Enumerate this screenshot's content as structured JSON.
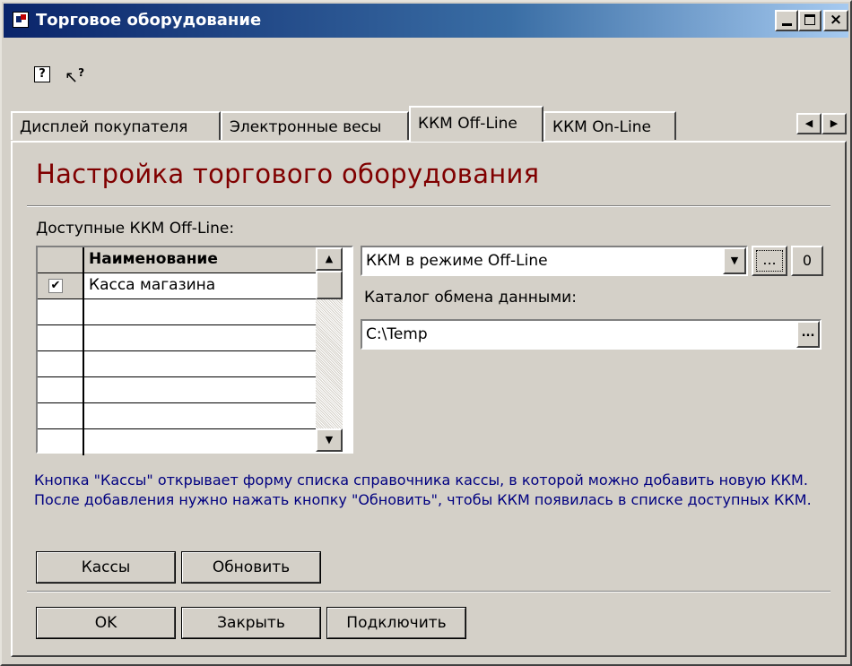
{
  "window": {
    "title": "Торговое оборудование",
    "minimize_icon": "minimize-icon",
    "maximize_icon": "maximize-icon",
    "close_icon": "close-icon",
    "close_glyph": "×"
  },
  "toolbar": {
    "help_glyph": "?",
    "context_help_glyph": "?"
  },
  "tabs": [
    {
      "label": "Дисплей покупателя"
    },
    {
      "label": "Электронные весы"
    },
    {
      "label": "ККМ Off-Line",
      "active": true
    },
    {
      "label": "ККМ On-Line"
    }
  ],
  "tab_scroll": {
    "left": "◀",
    "right": "▶"
  },
  "panel": {
    "heading": "Настройка торгового оборудования",
    "available_label": "Доступные ККМ Off-Line:",
    "grid": {
      "column_name": "Наименование",
      "rows": [
        {
          "checked": true,
          "name": "Касса магазина"
        },
        {
          "checked": false,
          "name": ""
        },
        {
          "checked": false,
          "name": ""
        },
        {
          "checked": false,
          "name": ""
        },
        {
          "checked": false,
          "name": ""
        },
        {
          "checked": false,
          "name": ""
        },
        {
          "checked": false,
          "name": ""
        }
      ],
      "check_glyph": "✔",
      "scroll_up": "▲",
      "scroll_down": "▼"
    },
    "mode_combo": {
      "value": "ККМ в режиме Off-Line",
      "drop_glyph": "▼"
    },
    "dots_button": "...",
    "zero_button": "0",
    "exchange_label": "Каталог обмена данными:",
    "exchange_path": "C:\\Temp",
    "browse_glyph": "...",
    "info_text": "Кнопка \"Кассы\" открывает форму списка справочника кассы, в которой можно добавить новую ККМ. После добавления нужно нажать кнопку \"Обновить\", чтобы ККМ появилась в списке доступных ККМ.",
    "buttons": {
      "kassy": "Кассы",
      "refresh": "Обновить",
      "ok": "OK",
      "close": "Закрыть",
      "connect": "Подключить"
    }
  }
}
